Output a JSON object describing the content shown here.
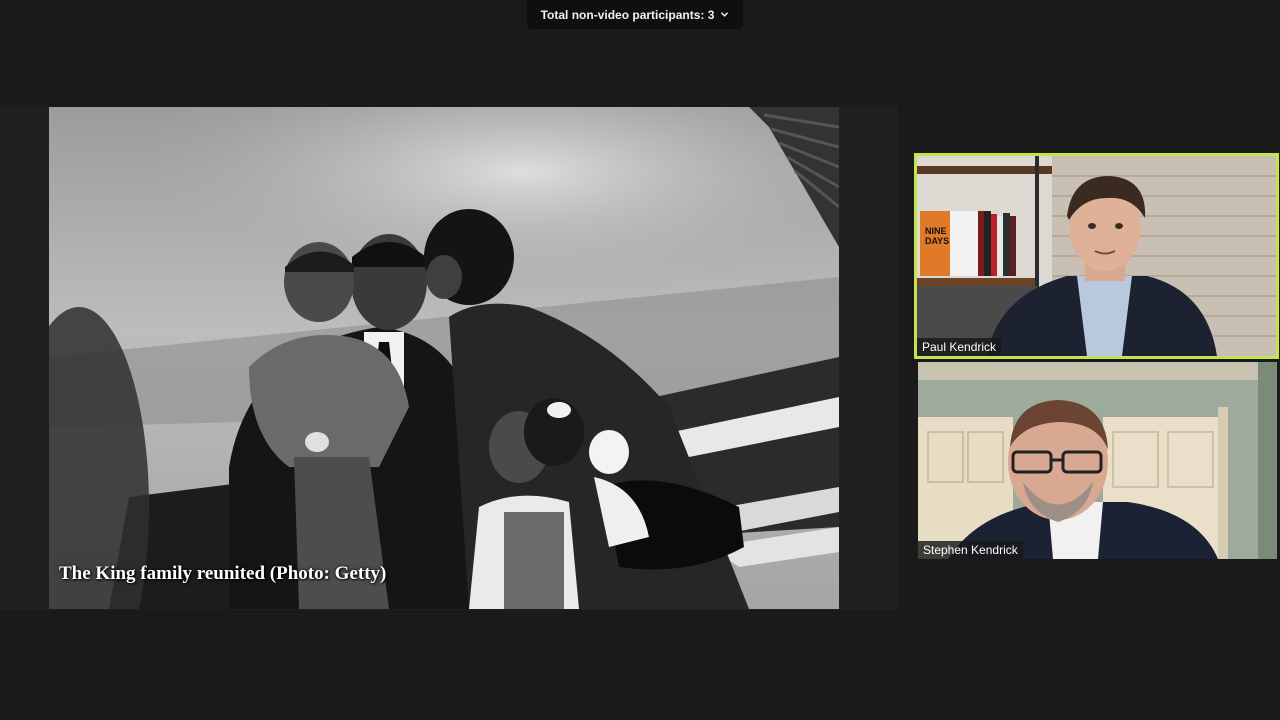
{
  "header": {
    "participants_label": "Total non-video participants: 3",
    "participants_icon": "chevron-down-icon"
  },
  "share": {
    "caption": "The King family reunited (Photo: Getty)"
  },
  "tiles": [
    {
      "name": "Paul Kendrick",
      "active_speaker": true,
      "highlight_color": "#c5e34c",
      "book_title": "NINE DAYS"
    },
    {
      "name": "Stephen Kendrick",
      "active_speaker": false
    }
  ],
  "colors": {
    "background": "#1a1a1a",
    "speaker_highlight": "#c5e34c"
  }
}
